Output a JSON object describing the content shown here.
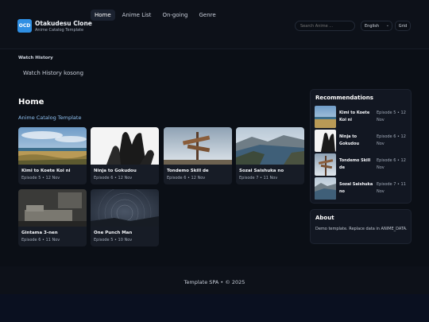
{
  "brand": {
    "logo": "OCD",
    "title": "Otakudesu Clone",
    "subtitle": "Anime Catalog Template"
  },
  "nav": [
    "Home",
    "Anime List",
    "On-going",
    "Genre"
  ],
  "nav_active": "Home",
  "search": {
    "placeholder": "Search Anime ..."
  },
  "language": {
    "selected": "English"
  },
  "view_toggle": "Grid",
  "watch_history": {
    "heading": "Watch History",
    "empty_text": "Watch History kosong"
  },
  "main": {
    "title": "Home",
    "subtitle": "Anime Catalog Template"
  },
  "cards": [
    {
      "title": "Kimi to Koete Koi ni",
      "meta": "Episode 5 • 12 Nov",
      "image": "beach-landscape"
    },
    {
      "title": "Ninja to Gokudou",
      "meta": "Episode 6 • 12 Nov",
      "image": "hands-bw"
    },
    {
      "title": "Tondemo Skill de",
      "meta": "Episode 6 • 12 Nov",
      "image": "signpost"
    },
    {
      "title": "Sozai Saishuka no",
      "meta": "Episode 7 • 11 Nov",
      "image": "fjord"
    },
    {
      "title": "Gintama 3-nen",
      "meta": "Episode 6 • 11 Nov",
      "image": "room"
    },
    {
      "title": "One Punch Man",
      "meta": "Episode 5 • 10 Nov",
      "image": "star-trails"
    }
  ],
  "recommendations": {
    "title": "Recommendations",
    "items": [
      {
        "title": "Kimi to Koete Koi ni",
        "meta": "Episode 5 • 12 Nov"
      },
      {
        "title": "Ninja to Gokudou",
        "meta": "Episode 6 • 12 Nov"
      },
      {
        "title": "Tondemo Skill de",
        "meta": "Episode 6 • 12 Nov"
      },
      {
        "title": "Sozai Saishuka no",
        "meta": "Episode 7 • 11 Nov"
      }
    ]
  },
  "about": {
    "title": "About",
    "text": "Demo template. Replace data in ANIME_DATA."
  },
  "footer": "Template SPA • © 2025",
  "colors": {
    "background": "#0b0f16",
    "accent": "#2f8fe3",
    "card": "#171c26",
    "link": "#8fc0f0"
  }
}
